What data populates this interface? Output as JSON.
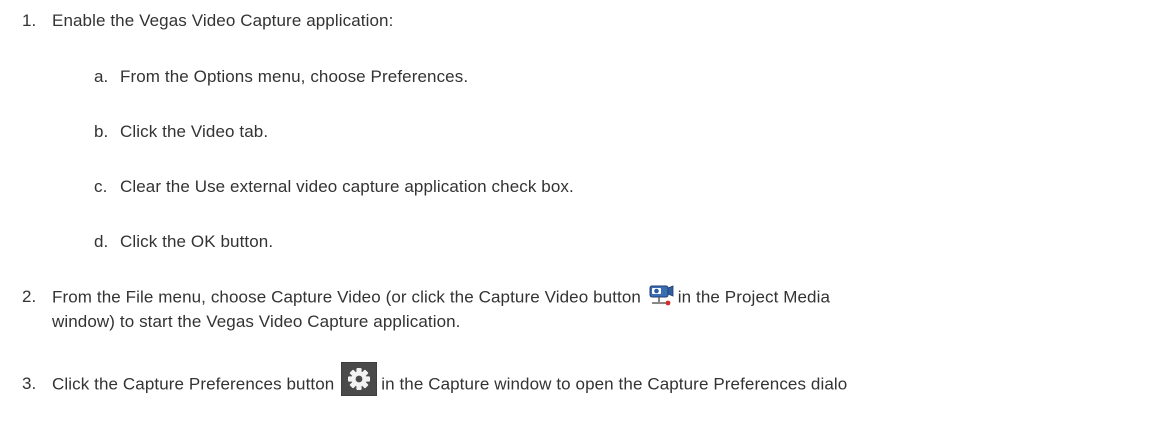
{
  "steps": [
    {
      "number": "1.",
      "text": "Enable the Vegas Video Capture application:",
      "substeps": [
        {
          "letter": "a.",
          "text": "From the Options menu, choose Preferences."
        },
        {
          "letter": "b.",
          "text": "Click the Video tab."
        },
        {
          "letter": "c.",
          "text": "Clear the Use external video capture application check box."
        },
        {
          "letter": "d.",
          "text": "Click the OK button."
        }
      ]
    },
    {
      "number": "2.",
      "text_before_icon": "From the File menu, choose Capture Video (or click the Capture Video button",
      "icon": "capture-video-camera-icon",
      "text_after_icon": "in the Project Media",
      "continuation": "window) to start the Vegas Video Capture application."
    },
    {
      "number": "3.",
      "text_before_icon": "Click the Capture Preferences button",
      "icon": "capture-preferences-gear-icon",
      "text_after_icon": "in the Capture window to open the Capture Preferences dialo"
    }
  ]
}
